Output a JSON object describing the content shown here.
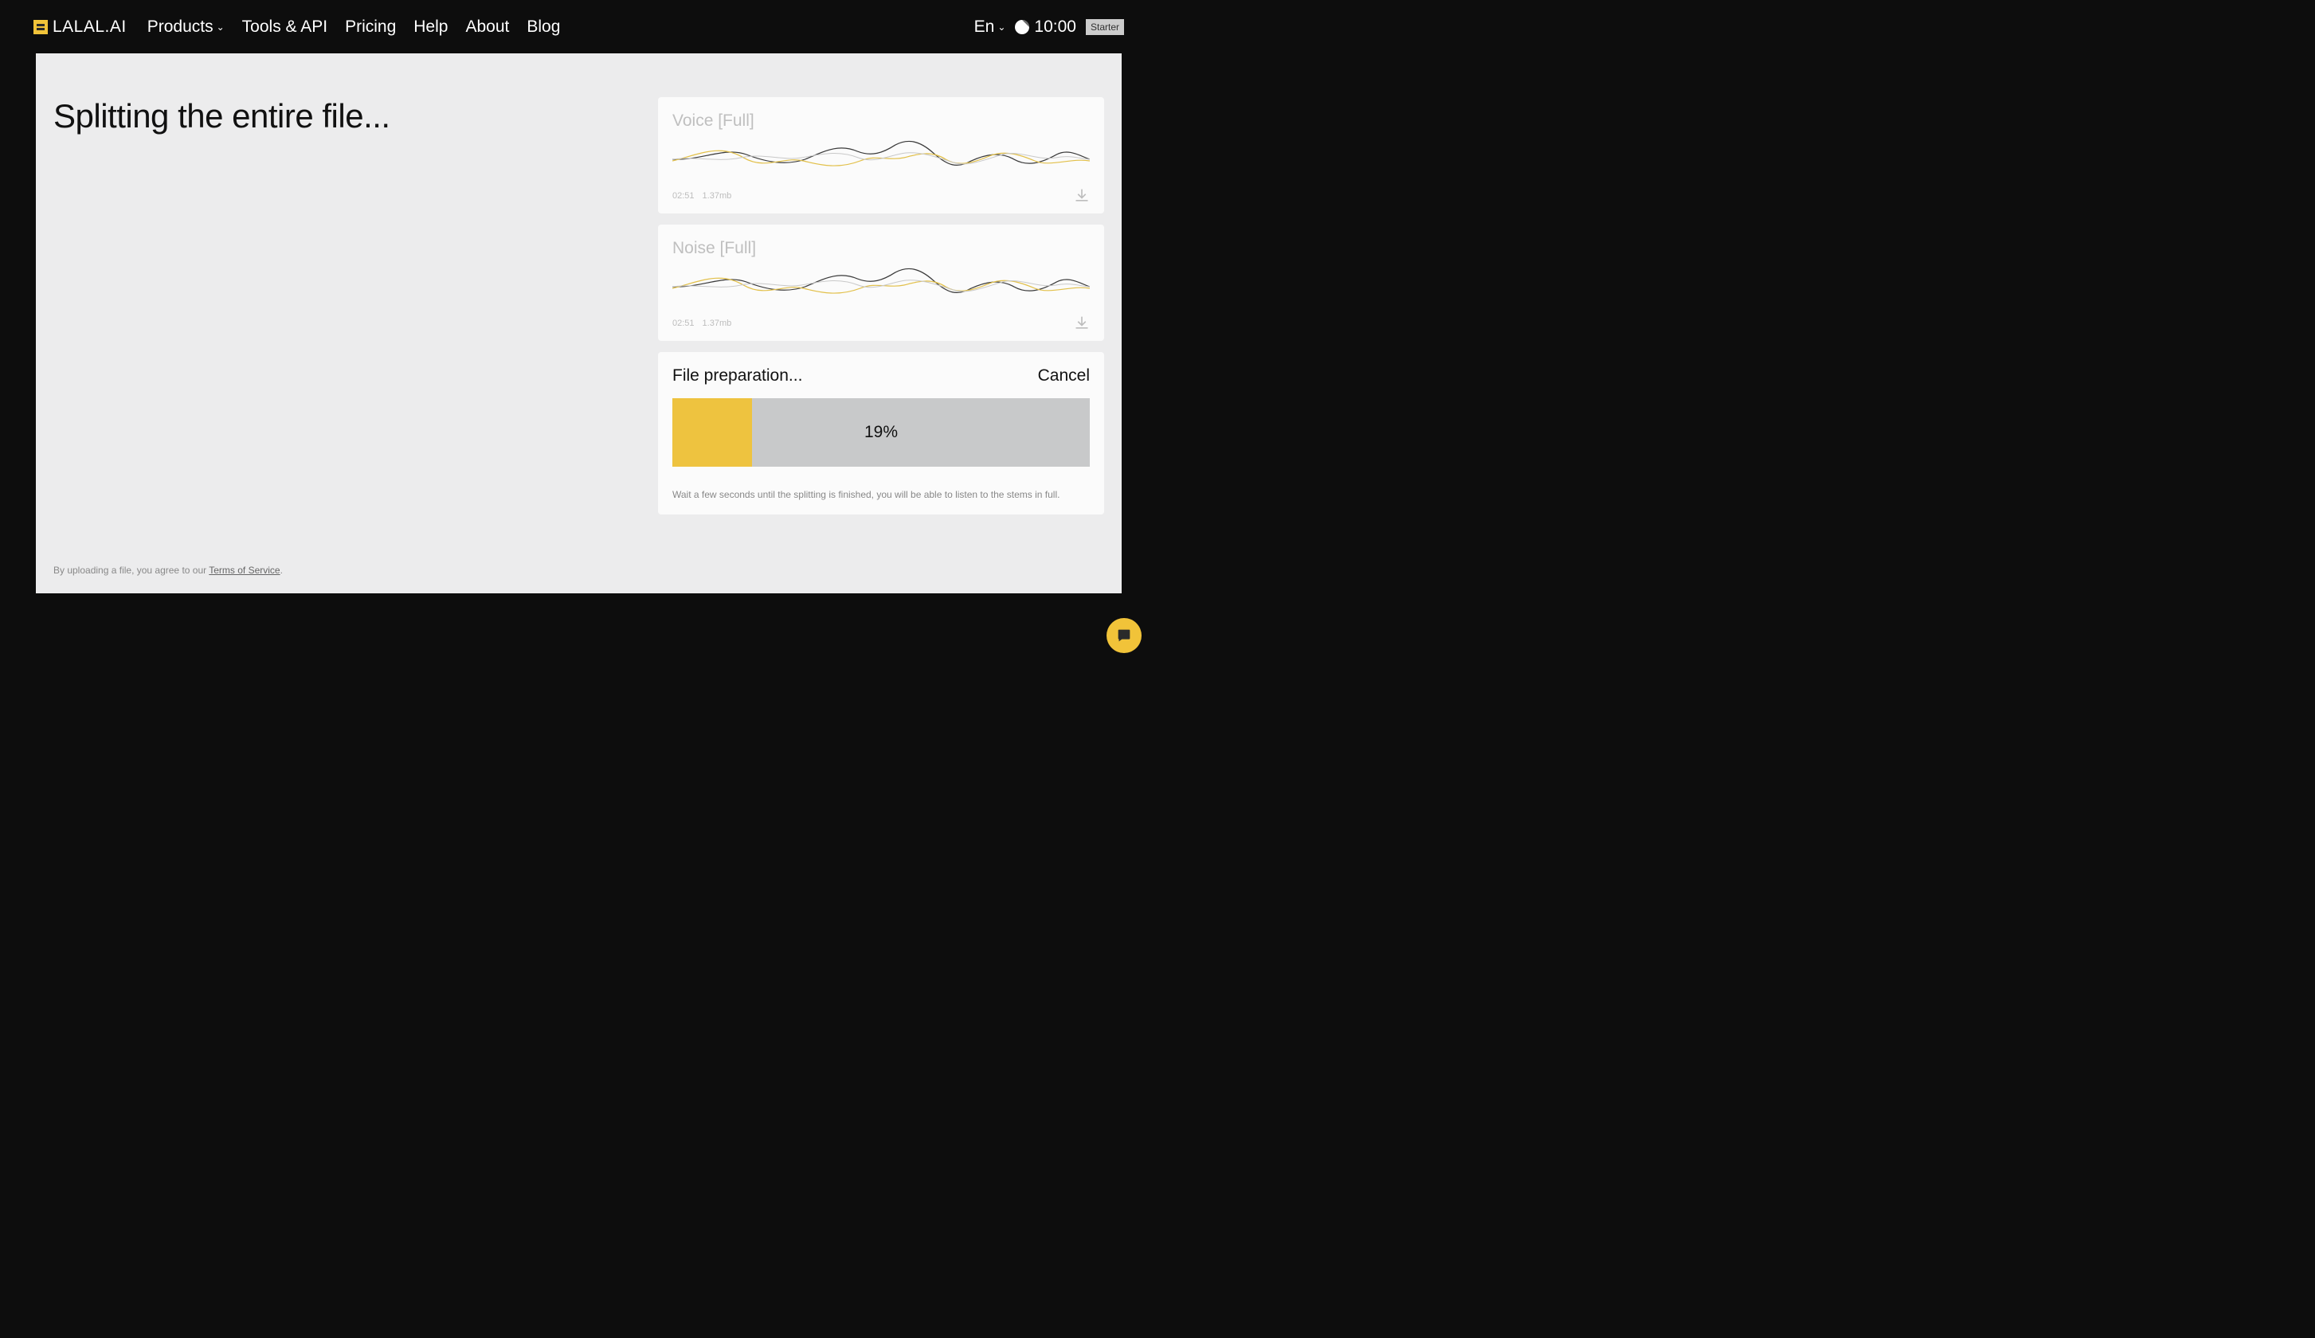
{
  "brand": {
    "name": "LALAL.AI"
  },
  "nav": {
    "products": "Products",
    "tools_api": "Tools & API",
    "pricing": "Pricing",
    "help": "Help",
    "about": "About",
    "blog": "Blog"
  },
  "header_right": {
    "lang": "En",
    "time": "10:00",
    "tier": "Starter"
  },
  "main": {
    "title": "Splitting the entire file...",
    "terms_prefix": "By uploading a file, you agree to our ",
    "terms_link": "Terms of Service",
    "terms_suffix": "."
  },
  "stems": [
    {
      "title": "Voice [Full]",
      "duration": "02:51",
      "size": "1.37mb"
    },
    {
      "title": "Noise [Full]",
      "duration": "02:51",
      "size": "1.37mb"
    }
  ],
  "progress": {
    "title": "File preparation...",
    "cancel": "Cancel",
    "percent": 19,
    "percent_text": "19%",
    "hint": "Wait a few seconds until the splitting is finished, you will be able to listen to the stems in full."
  }
}
